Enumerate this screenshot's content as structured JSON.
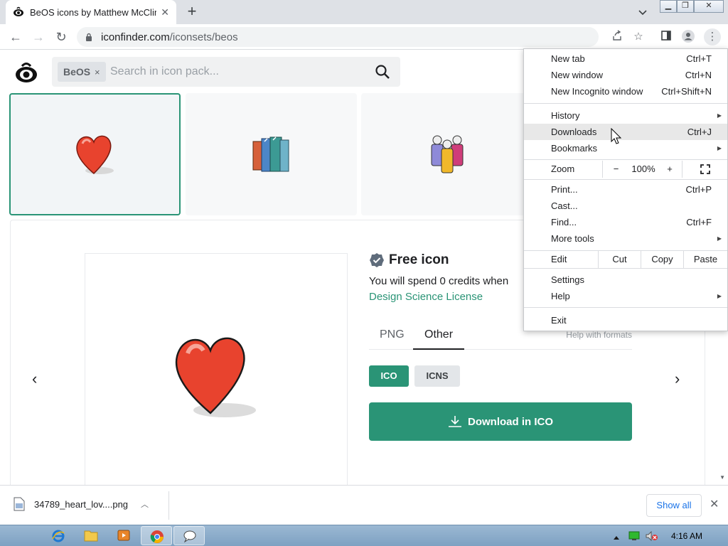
{
  "browser": {
    "tab_title": "BeOS icons by Matthew McClintock",
    "url_host": "iconfinder.com",
    "url_path": "/iconsets/beos"
  },
  "page": {
    "search_chip": "BeOS",
    "search_chip_close": "×",
    "search_placeholder": "Search in icon pack...",
    "free_label": "Free icon",
    "spend_text": "You will spend 0 credits when",
    "license": "Design Science License",
    "tabs": [
      "PNG",
      "Other"
    ],
    "help_formats": "Help with formats",
    "formats": [
      "ICO",
      "ICNS"
    ],
    "download_button": "Download in ICO",
    "icon_thumbs": [
      "heart-icon",
      "books-icon",
      "people-group-icon"
    ]
  },
  "menu": {
    "items": [
      {
        "label": "New tab",
        "shortcut": "Ctrl+T"
      },
      {
        "label": "New window",
        "shortcut": "Ctrl+N"
      },
      {
        "label": "New Incognito window",
        "shortcut": "Ctrl+Shift+N"
      },
      {
        "label": "History",
        "shortcut": ""
      },
      {
        "label": "Downloads",
        "shortcut": "Ctrl+J"
      },
      {
        "label": "Bookmarks",
        "shortcut": ""
      },
      {
        "label": "Print...",
        "shortcut": "Ctrl+P"
      },
      {
        "label": "Cast...",
        "shortcut": ""
      },
      {
        "label": "Find...",
        "shortcut": "Ctrl+F"
      },
      {
        "label": "More tools",
        "shortcut": ""
      },
      {
        "label": "Settings",
        "shortcut": ""
      },
      {
        "label": "Help",
        "shortcut": ""
      },
      {
        "label": "Exit",
        "shortcut": ""
      }
    ],
    "zoom": {
      "label": "Zoom",
      "minus": "−",
      "value": "100%",
      "plus": "+"
    },
    "edit": {
      "label": "Edit",
      "cut": "Cut",
      "copy": "Copy",
      "paste": "Paste"
    }
  },
  "shelf": {
    "filename": "34789_heart_lov....png",
    "show_all": "Show all"
  },
  "taskbar": {
    "clock": "4:16 AM"
  },
  "colors": {
    "accent": "#2a9476",
    "menu_highlight": "#e8e8e8",
    "link": "#1a73e8"
  }
}
